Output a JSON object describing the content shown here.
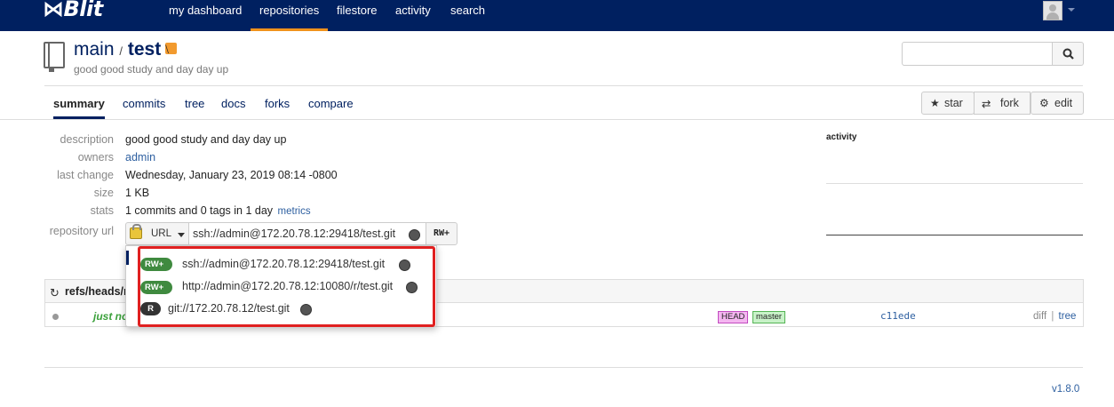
{
  "app": {
    "logo_text": "⋈Blit",
    "version": "v1.8.0"
  },
  "nav": {
    "items": [
      {
        "label": "my dashboard"
      },
      {
        "label": "repositories"
      },
      {
        "label": "filestore"
      },
      {
        "label": "activity"
      },
      {
        "label": "search"
      }
    ],
    "active": "repositories"
  },
  "repo": {
    "project": "main",
    "separator": "/",
    "name": "test",
    "description": "good good study and day day up"
  },
  "search": {
    "placeholder": ""
  },
  "tabs": [
    {
      "label": "summary"
    },
    {
      "label": "commits"
    },
    {
      "label": "tree"
    },
    {
      "label": "docs"
    },
    {
      "label": "forks"
    },
    {
      "label": "compare"
    }
  ],
  "actions": {
    "star": "star",
    "fork": "fork",
    "edit": "edit"
  },
  "summary": {
    "description_label": "description",
    "description_value": "good good study and day day up",
    "owners_label": "owners",
    "owners_value": "admin",
    "last_change_label": "last change",
    "last_change_value": "Wednesday, January 23, 2019 08:14 -0800",
    "size_label": "size",
    "size_value": "1 KB",
    "stats_label": "stats",
    "stats_value": "1 commits and 0 tags in 1 day",
    "metrics_link": "metrics",
    "repository_url_label": "repository url"
  },
  "activity_label": "activity",
  "url_control": {
    "protocol_label": "URL",
    "current_url": "ssh://admin@172.20.78.12:29418/test.git",
    "permission": "RW+"
  },
  "url_dropdown": [
    {
      "permission": "RW+",
      "url": "ssh://admin@172.20.78.12:29418/test.git"
    },
    {
      "permission": "RW+",
      "url": "http://admin@172.20.78.12:10080/r/test.git"
    },
    {
      "permission": "R",
      "url": "git://172.20.78.12/test.git"
    }
  ],
  "refs": {
    "title": "refs/heads/r",
    "row": {
      "when": "just no",
      "tag_head": "HEAD",
      "tag_branch": "master",
      "hash": "c11ede",
      "link_diff": "diff",
      "link_sep": "|",
      "link_tree": "tree"
    }
  },
  "colors": {
    "navbar": "#002060",
    "active_tab_accent": "#f0921c",
    "highlight_box": "#e02020"
  }
}
